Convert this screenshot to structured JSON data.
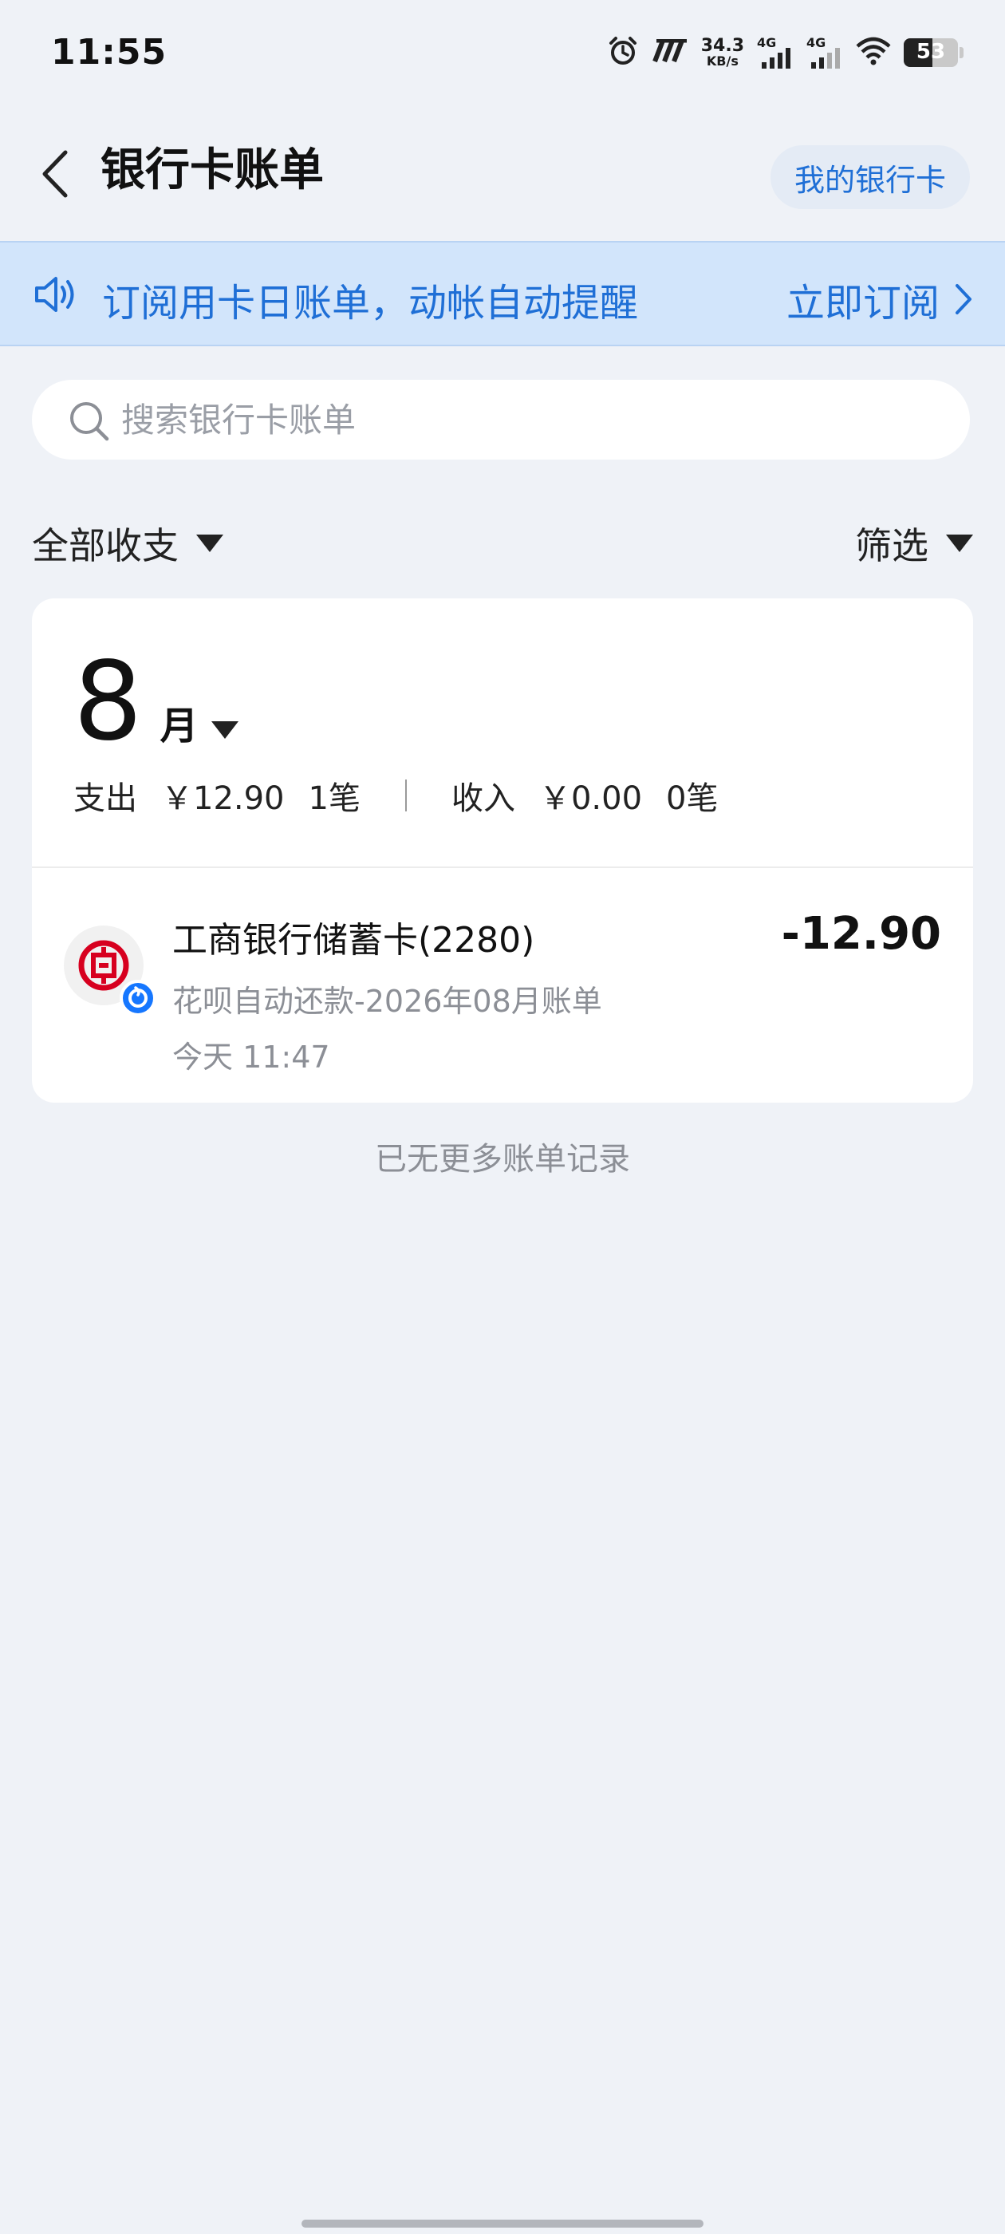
{
  "status_bar": {
    "time": "11:55",
    "net_speed_value": "34.3",
    "net_speed_unit": "KB/s",
    "sim1_label": "4G",
    "sim2_label": "4G",
    "battery": "53"
  },
  "nav": {
    "title": "银行卡账单",
    "my_cards_label": "我的银行卡"
  },
  "banner": {
    "text": "订阅用卡日账单，动帐自动提醒",
    "action_label": "立即订阅"
  },
  "search": {
    "placeholder": "搜索银行卡账单"
  },
  "filters": {
    "type_label": "全部收支",
    "screen_label": "筛选"
  },
  "month_summary": {
    "month": "8",
    "month_unit": "月",
    "expense_label": "支出",
    "expense_amount": "￥12.90",
    "expense_count": "1笔",
    "income_label": "收入",
    "income_amount": "￥0.00",
    "income_count": "0笔"
  },
  "transactions": [
    {
      "title": "工商银行储蓄卡(2280)",
      "description": "花呗自动还款-2026年08月账单",
      "time": "今天 11:47",
      "amount": "-12.90",
      "bank_icon": "icbc-logo-icon",
      "badge_icon": "huabei-icon"
    }
  ],
  "footer_note": "已无更多账单记录",
  "colors": {
    "accent": "#1f6fd6",
    "banner_bg": "#d2e5fb",
    "page_bg": "#eff2f7",
    "icbc_red": "#d7001f",
    "huabei_blue": "#1677ff"
  }
}
